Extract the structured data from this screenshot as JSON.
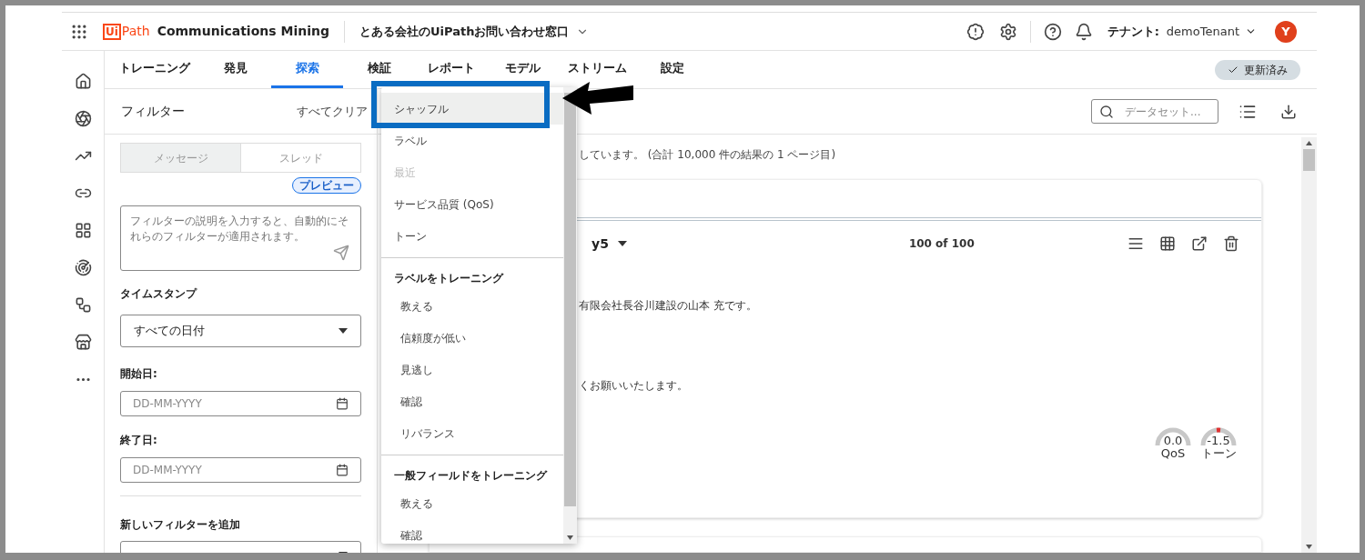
{
  "header": {
    "logo_box": "Ui",
    "logo_rest": "Path",
    "product": "Communications Mining",
    "project": "とある会社のUiPathお問い合わせ窓口",
    "tenant_label": "テナント:",
    "tenant": "demoTenant",
    "avatar": "Y"
  },
  "tabs": [
    {
      "label": "トレーニング",
      "selected": false
    },
    {
      "label": "発見",
      "selected": false
    },
    {
      "label": "探索",
      "selected": true
    },
    {
      "label": "検証",
      "selected": false
    },
    {
      "label": "レポート",
      "selected": false
    },
    {
      "label": "モデル",
      "selected": false
    },
    {
      "label": "ストリーム",
      "selected": false
    },
    {
      "label": "設定",
      "selected": false
    }
  ],
  "status_pill": "更新済み",
  "filters": {
    "title": "フィルター",
    "clear": "すべてクリア",
    "modes": [
      {
        "label": "メッセージ",
        "selected": true
      },
      {
        "label": "スレッド",
        "selected": false
      }
    ],
    "badge": "プレビュー",
    "prompt_placeholder": "フィルターの説明を入力すると、自動的にそれらのフィルターが適用されます。",
    "timestamp_label": "タイムスタンプ",
    "timestamp_value": "すべての日付",
    "start_label": "開始日:",
    "start_placeholder": "DD-MM-YYYY",
    "end_label": "終了日:",
    "end_placeholder": "DD-MM-YYYY",
    "add_label": "新しいフィルターを追加"
  },
  "toolbar": {
    "search_placeholder": "データセット..."
  },
  "results_summary": "しています。 (合計 10,000 件の結果の 1 ページ目)",
  "card": {
    "title_tail": "y5",
    "count": "100 of 100",
    "lines": [
      "有限会社長谷川建設の山本 充です。",
      "くお願いいたします。"
    ],
    "gauges": [
      {
        "value": "0.0",
        "label": "QoS",
        "marked": false
      },
      {
        "value": "-1.5",
        "label": "トーン",
        "marked": true
      }
    ]
  },
  "dropdown": {
    "sections": [
      {
        "items": [
          {
            "label": "シャッフル",
            "selected": true,
            "disabled": false
          },
          {
            "label": "ラベル",
            "selected": false,
            "disabled": false
          },
          {
            "label": "最近",
            "selected": false,
            "disabled": true
          },
          {
            "label": "サービス品質 (QoS)",
            "selected": false,
            "disabled": false
          },
          {
            "label": "トーン",
            "selected": false,
            "disabled": false
          }
        ]
      },
      {
        "title": "ラベルをトレーニング",
        "items": [
          {
            "label": "教える",
            "selected": false,
            "disabled": false
          },
          {
            "label": "信頼度が低い",
            "selected": false,
            "disabled": false
          },
          {
            "label": "見逃し",
            "selected": false,
            "disabled": false
          },
          {
            "label": "確認",
            "selected": false,
            "disabled": false
          },
          {
            "label": "リバランス",
            "selected": false,
            "disabled": false
          }
        ]
      },
      {
        "title": "一般フィールドをトレーニング",
        "items": [
          {
            "label": "教える",
            "selected": false,
            "disabled": false
          },
          {
            "label": "確認",
            "selected": false,
            "disabled": false
          }
        ]
      }
    ]
  }
}
